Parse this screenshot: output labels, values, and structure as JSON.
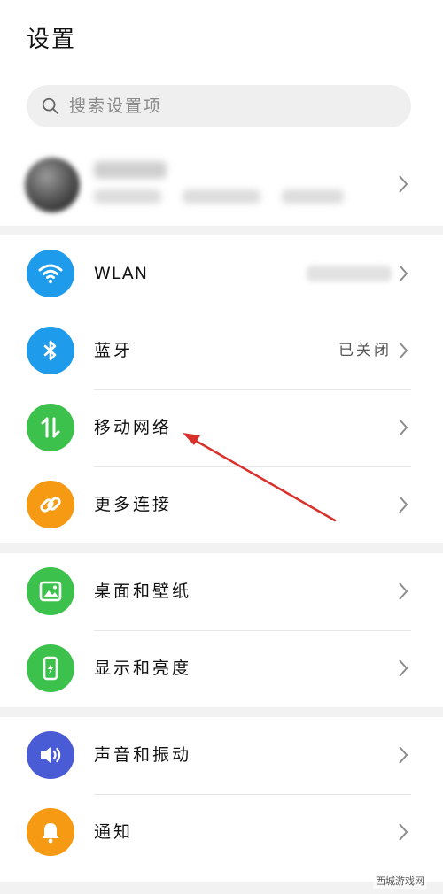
{
  "header": {
    "title": "设置"
  },
  "search": {
    "placeholder": "搜索设置项"
  },
  "connectivity": [
    {
      "label": "WLAN",
      "icon": "wifi-icon",
      "color": "#1e9bea"
    },
    {
      "label": "蓝牙",
      "status": "已关闭",
      "icon": "bluetooth-icon",
      "color": "#1e9bea"
    },
    {
      "label": "移动网络",
      "icon": "mobile-data-icon",
      "color": "#3cc24c"
    },
    {
      "label": "更多连接",
      "icon": "link-icon",
      "color": "#f59a12"
    }
  ],
  "display": [
    {
      "label": "桌面和壁纸",
      "icon": "image-icon",
      "color": "#3cc24c"
    },
    {
      "label": "显示和亮度",
      "icon": "phone-brightness-icon",
      "color": "#3cc24c"
    }
  ],
  "sound": [
    {
      "label": "声音和振动",
      "icon": "speaker-icon",
      "color": "#4a5bd6"
    },
    {
      "label": "通知",
      "icon": "bell-icon",
      "color": "#f59a12"
    }
  ],
  "watermark": {
    "text": "西城游戏网"
  }
}
